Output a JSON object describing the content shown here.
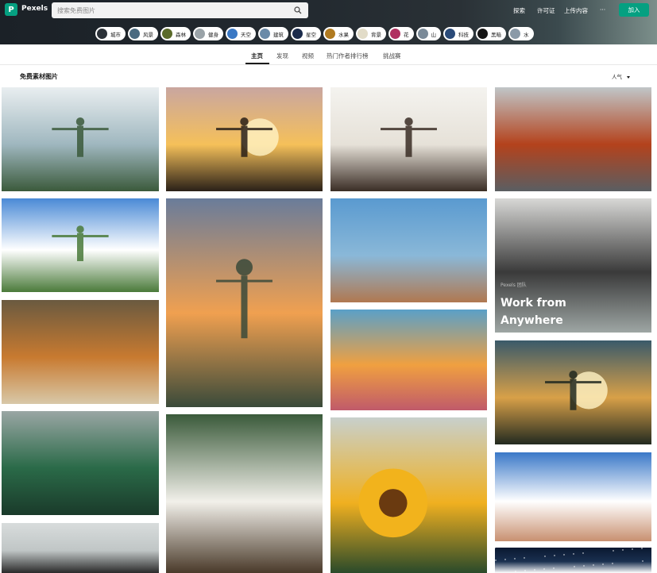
{
  "header": {
    "logo_letter": "P",
    "brand": "Pexels",
    "search_placeholder": "搜索免费图片",
    "nav": {
      "explore": "探索",
      "license": "许可证",
      "upload": "上传内容",
      "more": "···",
      "join": "加入"
    }
  },
  "chips": [
    {
      "label": "城市",
      "color": "#2b3138"
    },
    {
      "label": "风景",
      "color": "#4a6a80"
    },
    {
      "label": "森林",
      "color": "#5a6a2a"
    },
    {
      "label": "健身",
      "color": "#9aa3a8"
    },
    {
      "label": "天空",
      "color": "#3a78c4"
    },
    {
      "label": "建筑",
      "color": "#6a8aa8"
    },
    {
      "label": "星空",
      "color": "#1a2a4a"
    },
    {
      "label": "水果",
      "color": "#b07a20"
    },
    {
      "label": "背景",
      "color": "#e2dcc8"
    },
    {
      "label": "花",
      "color": "#b03060"
    },
    {
      "label": "山",
      "color": "#7a8a98"
    },
    {
      "label": "科技",
      "color": "#2a4a78"
    },
    {
      "label": "黑暗",
      "color": "#151515"
    },
    {
      "label": "水",
      "color": "#8a9aa8"
    }
  ],
  "tabs": [
    "主页",
    "发现",
    "视频",
    "热门作者排行榜",
    "挑战赛"
  ],
  "active_tab": "主页",
  "section_title": "免费素材图片",
  "sort_label": "人气",
  "ad": {
    "subtitle": "Pexels 团队",
    "title_line1": "Work from",
    "title_line2": "Anywhere"
  },
  "photos": [
    {
      "subject": "man-jumping-by-lake",
      "colors": [
        "#e9eef0",
        "#9fb7bf",
        "#3b5a3b"
      ]
    },
    {
      "subject": "woman-silhouette-sunset-pier",
      "colors": [
        "#c9a6a0",
        "#f5c05a",
        "#2a2018"
      ]
    },
    {
      "subject": "woman-raising-arm-bright-sky",
      "colors": [
        "#f4f3ef",
        "#e6e1d8",
        "#3a2d25"
      ]
    },
    {
      "subject": "autumn-road-red-trees",
      "colors": [
        "#c0c6c8",
        "#b4421c",
        "#5a5e62"
      ]
    },
    {
      "subject": "man-arms-wide-green-valley",
      "colors": [
        "#4a8ad6",
        "#ffffff",
        "#4a7a3a"
      ]
    },
    {
      "subject": "woman-arms-wide-mountain-sunrise",
      "colors": [
        "#6a7c9a",
        "#f0a050",
        "#3a4a3a"
      ]
    },
    {
      "subject": "hand-reaching-sea-sparkle",
      "colors": [
        "#5a9ad0",
        "#8ab8d8",
        "#b07850"
      ]
    },
    {
      "subject": "white-office-interior",
      "colors": [
        "#d8d8d6",
        "#3a3a3a",
        "#9ea6a4"
      ]
    },
    {
      "subject": "woman-autumn-leaves",
      "colors": [
        "#6a5a40",
        "#c87a30",
        "#d8c8a8"
      ]
    },
    {
      "subject": "pastel-mountain-layers-sunset",
      "colors": [
        "#5aa0c8",
        "#f0a040",
        "#c05a6a"
      ]
    },
    {
      "subject": "man-arms-up-golden-hour",
      "colors": [
        "#3a5a6a",
        "#d8a048",
        "#222a20"
      ]
    },
    {
      "subject": "person-in-green-bushes",
      "colors": [
        "#9aa6a4",
        "#2a6a48",
        "#1a3a2a"
      ]
    },
    {
      "subject": "woman-white-dress-in-tree",
      "colors": [
        "#3a5a3a",
        "#f2f0ea",
        "#4a3a2a"
      ]
    },
    {
      "subject": "sunflower-in-field",
      "colors": [
        "#c8d0cc",
        "#f0b020",
        "#2a4a2a"
      ]
    },
    {
      "subject": "hands-breaking-handcuffs-sky",
      "colors": [
        "#3a78c8",
        "#ffffff",
        "#c89070"
      ]
    },
    {
      "subject": "gray-sky-person",
      "colors": [
        "#d8dcdc",
        "#c0c6c6",
        "#2a2a2a"
      ]
    },
    {
      "subject": "starry-night-sky",
      "colors": [
        "#0a1830",
        "#1a3050",
        "#ffffff"
      ]
    }
  ]
}
